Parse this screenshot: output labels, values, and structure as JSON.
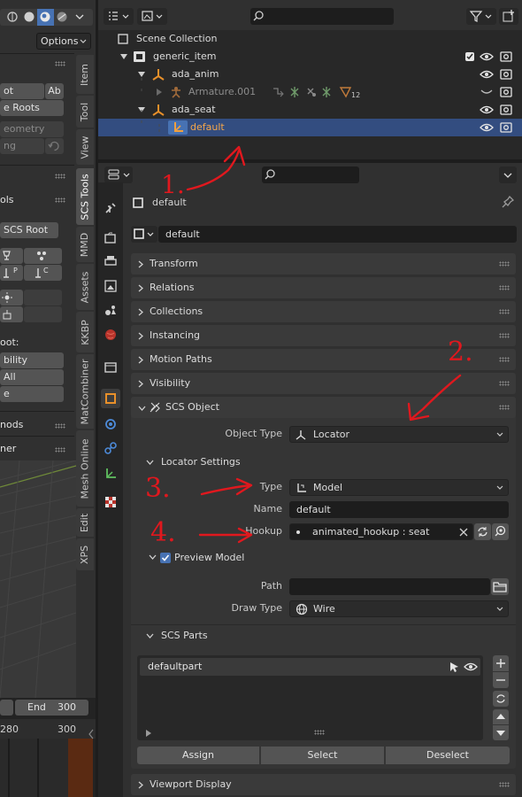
{
  "left": {
    "options_label": "Options",
    "ab_glyph": "Ab",
    "buttons": [
      "ot",
      "e Roots",
      "eometry",
      "ng"
    ],
    "section_tools": "ols",
    "scs_root_button": "SCS Root",
    "loc_p": "P",
    "loc_c": "C",
    "oot_label": "oot:",
    "vis_buttons": [
      "bility",
      "All",
      "e"
    ],
    "nods": "nods",
    "ner": "ner",
    "end_label": "End",
    "end_value": "300",
    "start_value": "",
    "ruler": [
      "280",
      "300"
    ],
    "tabs": [
      "Item",
      "Tool",
      "View",
      "SCS Tools",
      "MMD",
      "Assets",
      "KKBP",
      "MatCombiner",
      "Mesh Online",
      "Edit",
      "XPS"
    ]
  },
  "outliner": {
    "rows": [
      {
        "name": "Scene Collection",
        "icon": "collection-icon"
      },
      {
        "name": "generic_item",
        "icon": "collection-icon"
      },
      {
        "name": "ada_anim",
        "icon": "empty-icon"
      },
      {
        "name": "Armature.001",
        "icon": "armature-icon"
      },
      {
        "name": "ada_seat",
        "icon": "empty-icon"
      },
      {
        "name": "default",
        "icon": "empty-icon"
      }
    ],
    "armature_badge": "12"
  },
  "props": {
    "object_name_header": "default",
    "name_field": "default",
    "panels": [
      "Transform",
      "Relations",
      "Collections",
      "Instancing",
      "Motion Paths",
      "Visibility"
    ],
    "scs_object": {
      "title": "SCS Object",
      "object_type_label": "Object Type",
      "object_type_value": "Locator",
      "locator_settings": "Locator Settings",
      "type_label": "Type",
      "type_value": "Model",
      "name_label": "Name",
      "name_value": "default",
      "hookup_label": "Hookup",
      "hookup_value": "animated_hookup : seat",
      "preview_model_label": "Preview Model",
      "path_label": "Path",
      "path_value": "",
      "draw_type_label": "Draw Type",
      "draw_type_value": "Wire"
    },
    "scs_parts": {
      "title": "SCS Parts",
      "items": [
        "defaultpart"
      ],
      "buttons": [
        "Assign",
        "Select",
        "Deselect"
      ]
    },
    "viewport_display": "Viewport Display"
  },
  "annotations": [
    "1.",
    "2.",
    "3.",
    "4."
  ],
  "colors": {
    "selection": "#334d80",
    "accent_orange": "#e8902a",
    "annotation_red": "#e0181e"
  }
}
